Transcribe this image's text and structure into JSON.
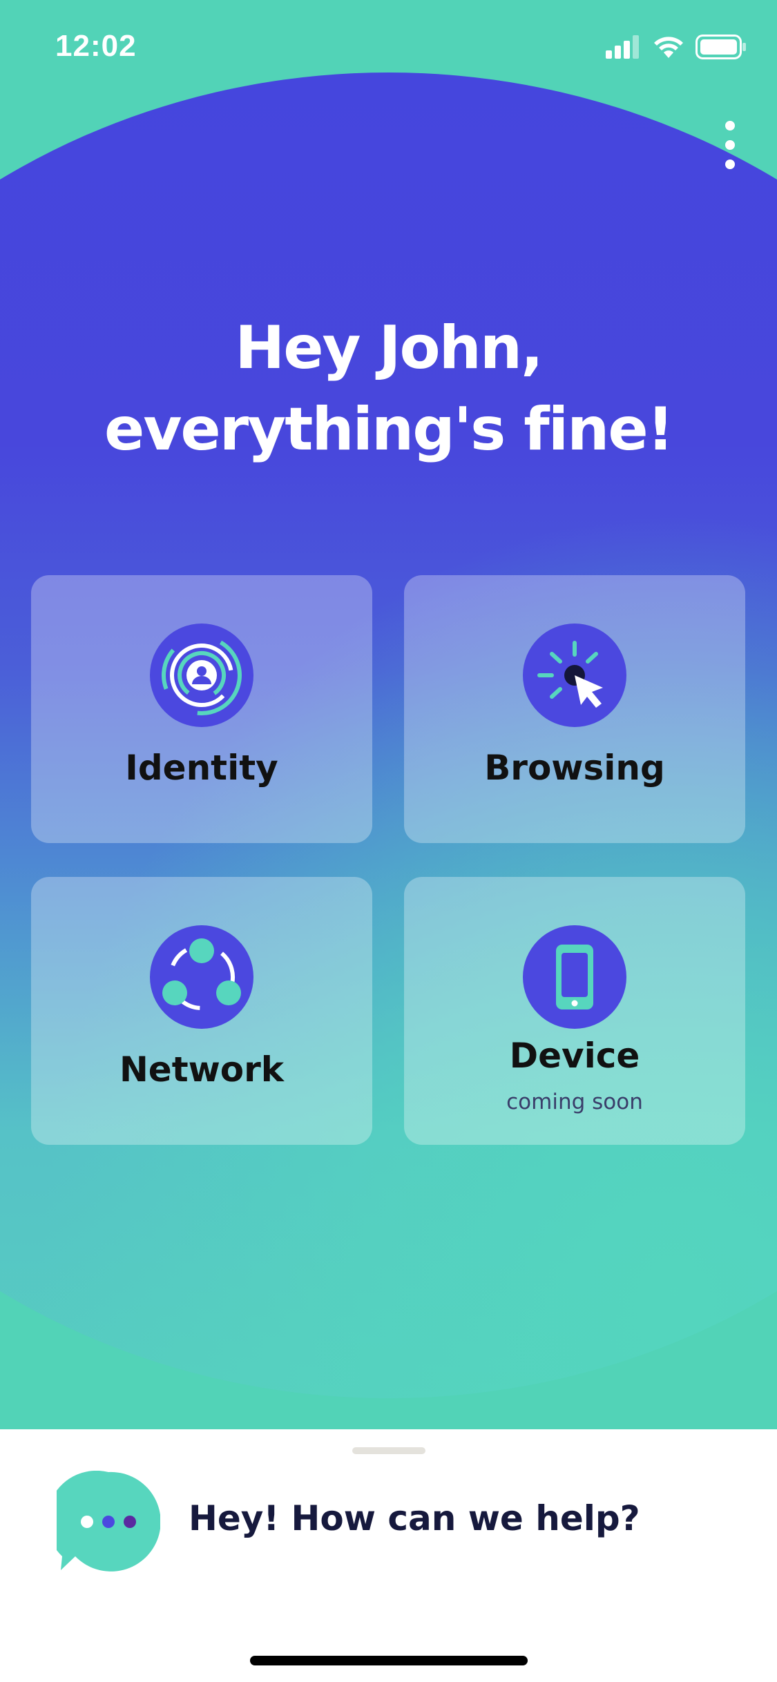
{
  "status_bar": {
    "time": "12:02",
    "icons": [
      "cellular-signal-icon",
      "wifi-icon",
      "battery-icon"
    ]
  },
  "header": {
    "menu_icon": "more-vertical-icon",
    "greeting": "Hey John, everything's fine!"
  },
  "tiles": [
    {
      "label": "Identity",
      "icon": "identity-icon",
      "subtext": ""
    },
    {
      "label": "Browsing",
      "icon": "browsing-cursor-icon",
      "subtext": ""
    },
    {
      "label": "Network",
      "icon": "network-icon",
      "subtext": ""
    },
    {
      "label": "Device",
      "icon": "mobile-device-icon",
      "subtext": "coming soon"
    }
  ],
  "help_sheet": {
    "message": "Hey! How can we help?",
    "icon": "chat-bubble-icon"
  },
  "colors": {
    "accent_purple": "#4b48df",
    "accent_teal": "#52d3b7",
    "text_dark": "#16193d",
    "tile_label": "#111111"
  }
}
